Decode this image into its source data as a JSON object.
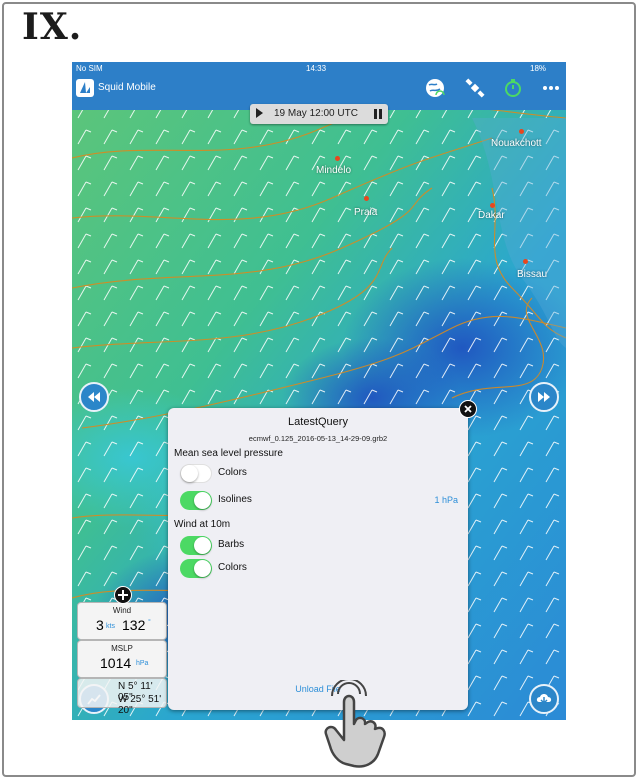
{
  "page": {
    "heading": "IX."
  },
  "status": {
    "carrier": "No SIM",
    "time": "14:33",
    "battery": "18%"
  },
  "nav": {
    "app_title": "Squid Mobile"
  },
  "timebar": {
    "label": "19 May 12:00 UTC"
  },
  "places": [
    "Nouakchott",
    "Mindelo",
    "Praia",
    "Dakar",
    "Bissau"
  ],
  "panel": {
    "title": "LatestQuery",
    "filename": "ecmwf_0.125_2016-05-13_14-29-09.grb2",
    "section_mslp": "Mean sea level pressure",
    "mslp_colors_label": "Colors",
    "mslp_colors_on": false,
    "isolines_label": "Isolines",
    "isolines_on": true,
    "isolines_value": "1 hPa",
    "section_wind": "Wind at 10m",
    "barbs_label": "Barbs",
    "barbs_on": true,
    "wind_colors_label": "Colors",
    "wind_colors_on": true,
    "unload_label": "Unload File"
  },
  "info": {
    "wind_title": "Wind",
    "wind_speed": "3",
    "wind_speed_unit": "kts",
    "wind_dir": "132",
    "wind_dir_unit": "°",
    "mslp_title": "MSLP",
    "mslp_value": "1014",
    "mslp_unit": "hPa",
    "lat": "N 5° 11' 05\"",
    "lon": "W 25° 51' 20\""
  },
  "colors": {
    "navbar": "#2d7fc8",
    "toggle_on": "#4cd964",
    "accent": "#2e8fd8"
  }
}
